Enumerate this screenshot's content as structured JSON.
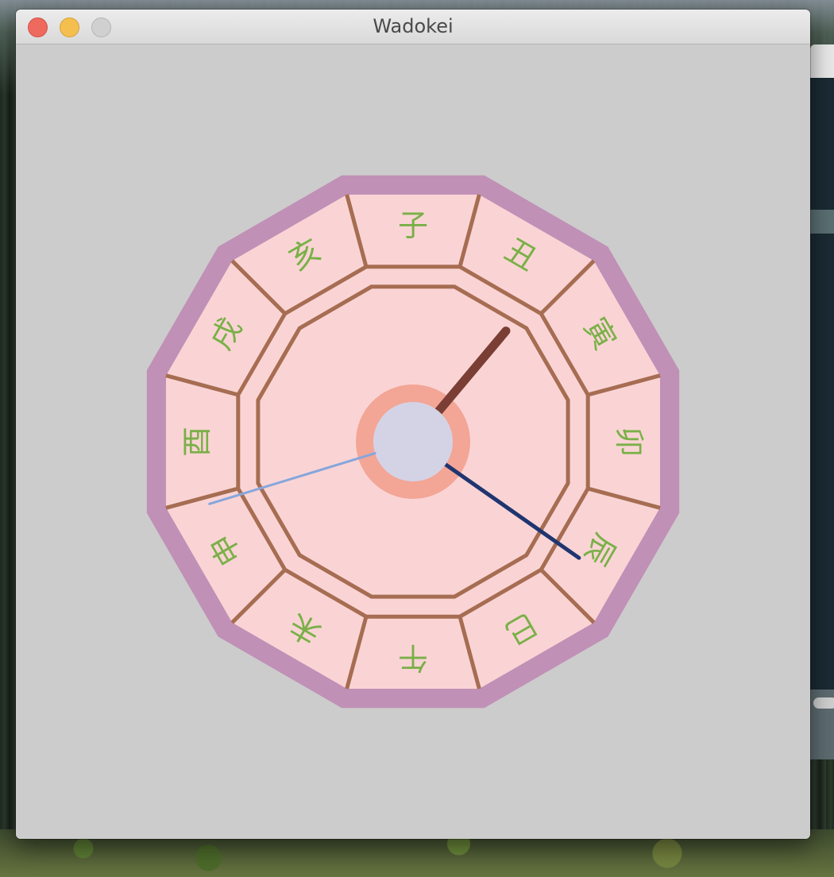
{
  "window": {
    "title": "Wadokei",
    "controls": [
      "close",
      "minimize",
      "zoom"
    ]
  },
  "clock": {
    "hour_labels": [
      "子",
      "丑",
      "寅",
      "卯",
      "辰",
      "巳",
      "午",
      "未",
      "申",
      "酉",
      "戌",
      "亥"
    ],
    "colors": {
      "outer_rim": "#c090b6",
      "face": "#fad4d5",
      "divider_lines": "#a66d52",
      "labels": "#7ab048",
      "hub_ring": "#f3a596",
      "hub_center": "#d4d3e6",
      "hour_hand": "#7a3e34",
      "minute_hand": "#1f3570",
      "second_hand": "#86a6dc"
    },
    "hands": {
      "hour_angle_deg": 40,
      "minute_angle_deg": 125,
      "second_angle_deg": 253
    }
  }
}
